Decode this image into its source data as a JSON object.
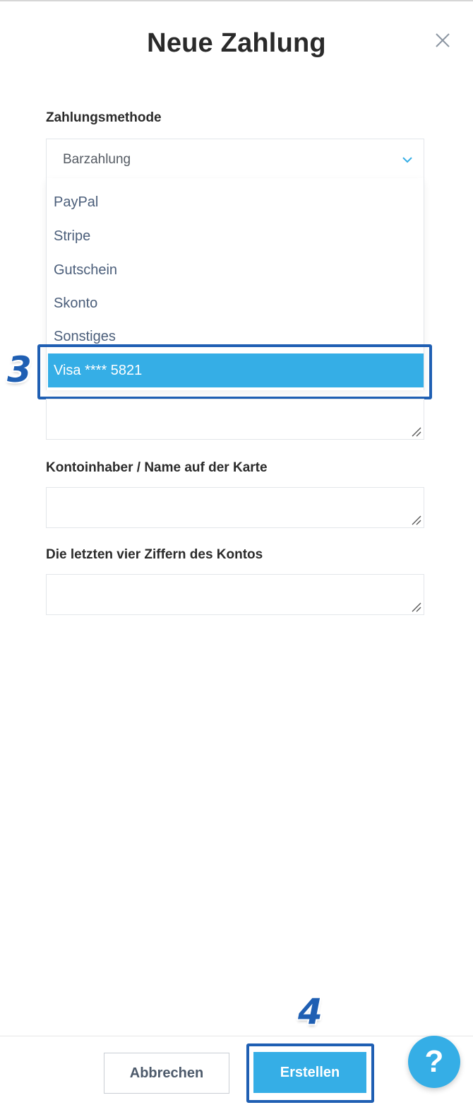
{
  "dialog": {
    "title": "Neue Zahlung"
  },
  "form": {
    "payment_method": {
      "label": "Zahlungsmethode",
      "selected": "Barzahlung",
      "options": [
        "PayPal",
        "Stripe",
        "Gutschein",
        "Skonto",
        "Sonstiges",
        "Visa **** 5821"
      ],
      "highlighted_option": "Visa **** 5821"
    },
    "account_holder": {
      "label": "Kontoinhaber / Name auf der Karte",
      "value": ""
    },
    "last_four": {
      "label": "Die letzten vier Ziffern des Kontos",
      "value": ""
    }
  },
  "footer": {
    "cancel_label": "Abbrechen",
    "create_label": "Erstellen",
    "help_label": "?"
  },
  "annotations": {
    "step_dropdown": "3",
    "step_create": "4"
  },
  "colors": {
    "accent": "#35aee6",
    "annotation": "#1f5fb3",
    "option_text": "#4b5e7a"
  },
  "icons": {
    "close": "close-icon",
    "chevron": "chevron-down-icon",
    "resize": "resize-handle-icon",
    "help": "help-icon"
  }
}
